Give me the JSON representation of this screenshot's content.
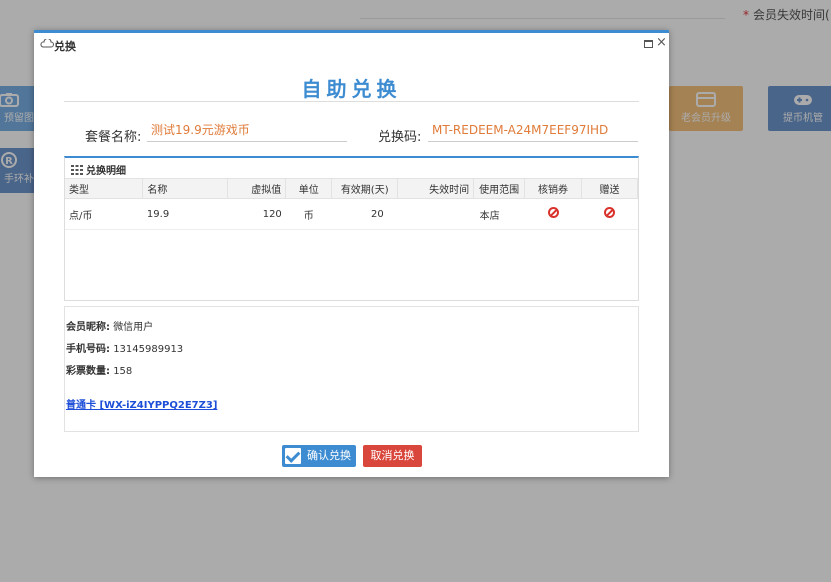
{
  "background": {
    "expire_required_mark": "*",
    "expire_label": "会员失效时间(",
    "tiles": [
      {
        "label": "预留图",
        "icon": "camera-icon",
        "color": "#7ab0e6"
      },
      {
        "label": "手环补",
        "icon": "registered-icon",
        "color": "#6e97cd"
      },
      {
        "label": "老会员升级",
        "icon": "card-icon",
        "color": "#f6c27c"
      },
      {
        "label": "提币机管",
        "icon": "gamepad-icon",
        "color": "#6e97cd"
      }
    ]
  },
  "dialog": {
    "title": "兑换",
    "heading": "自助兑换",
    "package_label": "套餐名称:",
    "package_value": "测试19.9元游戏币",
    "code_label": "兑换码:",
    "code_value": "MT-REDEEM-A24M7EEF97IHD",
    "detail_title": "兑换明细",
    "columns": [
      "类型",
      "名称",
      "虚拟值",
      "单位",
      "有效期(天)",
      "失效时间",
      "使用范围",
      "核销券",
      "赠送"
    ],
    "rows": [
      {
        "type": "点/币",
        "name": "19.9",
        "virtual_value": "120",
        "unit": "币",
        "valid_days": "20",
        "expire_time": "",
        "scope": "本店",
        "voucher": "ban-icon",
        "gift": "ban-icon"
      }
    ],
    "member": {
      "nickname_label": "会员昵称:",
      "nickname": "微信用户",
      "phone_label": "手机号码:",
      "phone": "13145989913",
      "lottery_label": "彩票数量:",
      "lottery": "158",
      "card_link": "普通卡 [WX-iZ4IYPPQ2E7Z3]"
    },
    "confirm_label": "确认兑换",
    "cancel_label": "取消兑换"
  },
  "colors": {
    "accent": "#3d8cd1",
    "highlight": "#e07b39",
    "danger": "#d9463b"
  }
}
